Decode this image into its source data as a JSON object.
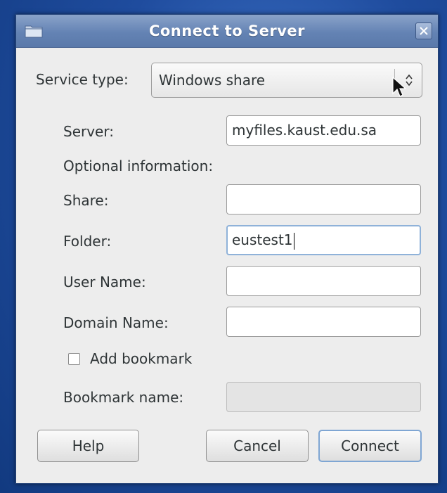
{
  "window": {
    "title": "Connect to Server"
  },
  "service": {
    "label": "Service type:",
    "selected": "Windows share"
  },
  "fields": {
    "server_label": "Server:",
    "server_value": "myfiles.kaust.edu.sa",
    "optional_heading": "Optional information:",
    "share_label": "Share:",
    "share_value": "",
    "folder_label": "Folder:",
    "folder_value": "eustest1",
    "username_label": "User Name:",
    "username_value": "",
    "domain_label": "Domain Name:",
    "domain_value": ""
  },
  "bookmark": {
    "checkbox_label": "Add bookmark",
    "checked": false,
    "name_label": "Bookmark name:",
    "name_value": ""
  },
  "buttons": {
    "help": "Help",
    "cancel": "Cancel",
    "connect": "Connect"
  },
  "icons": {
    "title": "folder-icon",
    "close": "close-icon",
    "combo": "chevron-up-down-icon",
    "pointer": "mouse-pointer-icon"
  }
}
